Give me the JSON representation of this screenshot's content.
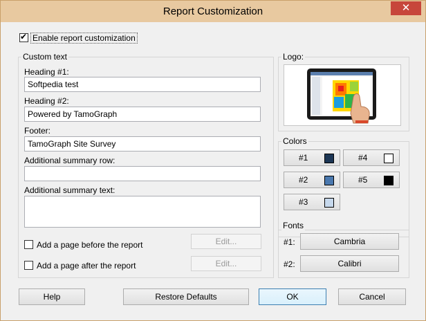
{
  "window": {
    "title": "Report Customization",
    "close_glyph": "✕"
  },
  "enable": {
    "label": "Enable report customization",
    "checked": true
  },
  "custom_text": {
    "group_label": "Custom text",
    "heading1": {
      "label": "Heading #1:",
      "value": "Softpedia test"
    },
    "heading2": {
      "label": "Heading #2:",
      "value": "Powered by TamoGraph"
    },
    "footer": {
      "label": "Footer:",
      "value": "TamoGraph Site Survey"
    },
    "summary_row": {
      "label": "Additional summary row:",
      "value": ""
    },
    "summary_text": {
      "label": "Additional summary text:",
      "value": ""
    },
    "page_before": {
      "label": "Add a page before the report",
      "checked": false,
      "edit_label": "Edit..."
    },
    "page_after": {
      "label": "Add a page after the report",
      "checked": false,
      "edit_label": "Edit..."
    }
  },
  "logo": {
    "label": "Logo:"
  },
  "colors": {
    "group_label": "Colors",
    "items": [
      {
        "label": "#1",
        "hex": "#1c3655"
      },
      {
        "label": "#4",
        "hex": "#ffffff"
      },
      {
        "label": "#2",
        "hex": "#4a78ae"
      },
      {
        "label": "#5",
        "hex": "#000000"
      },
      {
        "label": "#3",
        "hex": "#c6d8ec"
      }
    ]
  },
  "fonts": {
    "group_label": "Fonts",
    "items": [
      {
        "label": "#1:",
        "value": "Cambria"
      },
      {
        "label": "#2:",
        "value": "Calibri"
      }
    ]
  },
  "buttons": {
    "help": "Help",
    "restore": "Restore Defaults",
    "ok": "OK",
    "cancel": "Cancel"
  }
}
